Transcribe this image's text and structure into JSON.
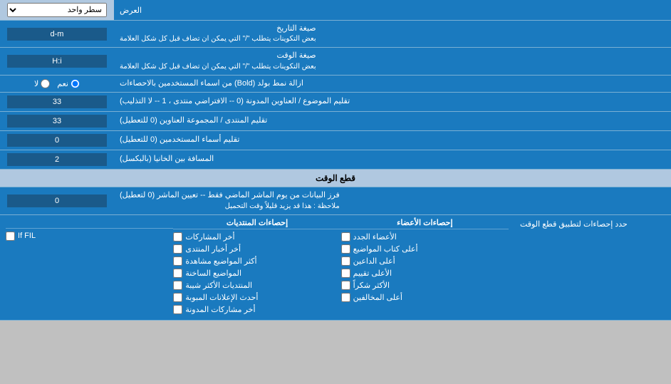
{
  "page": {
    "title": "العرض",
    "section_display": "العرض",
    "row_single": "سطر واحد",
    "date_format_label": "صيغة التاريخ",
    "date_format_hint": "بعض التكوينات يتطلب \"/\" التي يمكن ان تضاف قبل كل شكل العلامة",
    "date_format_value": "d-m",
    "time_format_label": "صيغة الوقت",
    "time_format_hint": "بعض التكوينات يتطلب \"/\" التي يمكن ان تضاف قبل كل شكل العلامة",
    "time_format_value": "H:i",
    "bold_label": "ازالة نمط بولد (Bold) من اسماء المستخدمين بالاحصاءات",
    "bold_yes": "نعم",
    "bold_no": "لا",
    "topics_label": "تقليم الموضوع / العناوين المدونة (0 -- الافتراضي منتدى ، 1 -- لا التذليب)",
    "topics_value": "33",
    "forum_label": "تقليم المنتدى / المجموعة العناوين (0 للتعطيل)",
    "forum_value": "33",
    "users_label": "تقليم أسماء المستخدمين (0 للتعطيل)",
    "users_value": "0",
    "gap_label": "المسافة بين الخانيا (بالبكسل)",
    "gap_value": "2",
    "section_cutoff": "قطع الوقت",
    "cutoff_label": "فرز البيانات من يوم الماشر الماضي فقط -- تعيين الماشر (0 لتعطيل)",
    "cutoff_note": "ملاحظة : هذا قد يزيد قليلاً وقت التحميل",
    "cutoff_value": "0",
    "limit_label": "حدد إحصاءات لتطبيق قطع الوقت",
    "columns": {
      "col1_header": "إحصاءات الأعضاء",
      "col1_items": [
        "الأعضاء الجدد",
        "أعلى كتاب المواضيع",
        "أعلى الداعين",
        "الأعلى تقييم",
        "الأكثر شكراً",
        "أعلى المخالفين"
      ],
      "col2_header": "إحصاءات المنتديات",
      "col2_items": [
        "أخر المشاركات",
        "أخر أخبار المنتدى",
        "أكثر المواضيع مشاهدة",
        "المواضيع الساخنة",
        "المنتديات الأكثر شيبة",
        "أحدث الإعلانات المبوبة",
        "أخر مشاركات المدونة"
      ],
      "col3_header": "",
      "col3_items": [
        "If FIL"
      ]
    }
  }
}
